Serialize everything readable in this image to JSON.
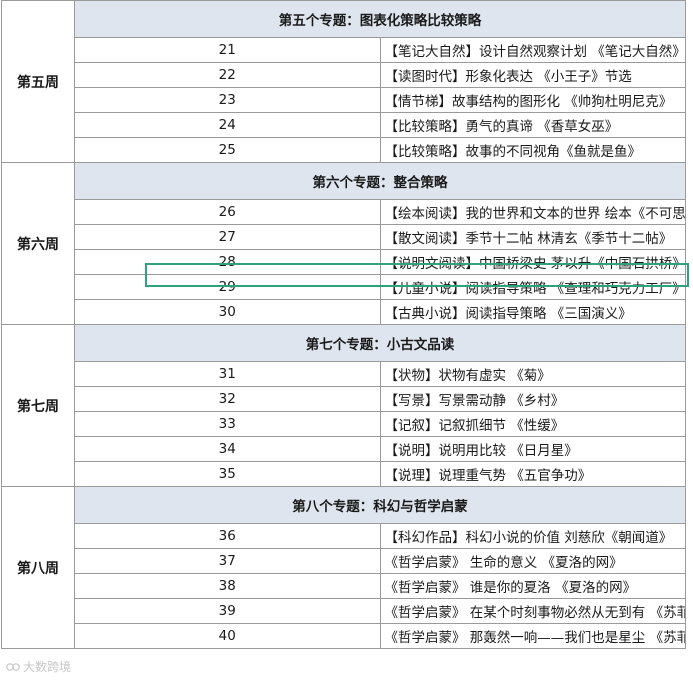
{
  "weeks": [
    {
      "week_label": "第五周",
      "topic": "第五个专题：图表化策略比较策略",
      "rows": [
        {
          "num": "21",
          "text": "【笔记大自然】设计自然观察计划 《笔记大自然》片段"
        },
        {
          "num": "22",
          "text": "【读图时代】形象化表达 《小王子》节选"
        },
        {
          "num": "23",
          "text": "【情节梯】故事结构的图形化 《帅狗杜明尼克》"
        },
        {
          "num": "24",
          "text": "【比较策略】勇气的真谛 《香草女巫》"
        },
        {
          "num": "25",
          "text": "【比较策略】故事的不同视角《鱼就是鱼》"
        }
      ]
    },
    {
      "week_label": "第六周",
      "topic": "第六个专题：整合策略",
      "rows": [
        {
          "num": "26",
          "text": "【绘本阅读】我的世界和文本的世界 绘本《不可思议的旅程》（ 文本的世界 ）"
        },
        {
          "num": "27",
          "text": "【散文阅读】季节十二帖 林清玄《季节十二帖》"
        },
        {
          "num": "28",
          "text": "【说明文阅读】中国桥梁史 茅以升《中国石拱桥》"
        },
        {
          "num": "29",
          "text": "【儿童小说】阅读指导策略 《查理和巧克力工厂》（ 威利 ）"
        },
        {
          "num": "30",
          "text": "【古典小说】阅读指导策略 《三国演义》"
        }
      ]
    },
    {
      "week_label": "第七周",
      "topic": "第七个专题：小古文品读",
      "rows": [
        {
          "num": "31",
          "text": "【状物】状物有虚实 《菊》"
        },
        {
          "num": "32",
          "text": "【写景】写景需动静 《乡村》"
        },
        {
          "num": "33",
          "text": "【记叙】记叙抓细节 《性缓》"
        },
        {
          "num": "34",
          "text": "【说明】说明用比较 《日月星》"
        },
        {
          "num": "35",
          "text": "【说理】说理重气势 《五官争功》"
        }
      ]
    },
    {
      "week_label": "第八周",
      "topic": "第八个专题：科幻与哲学启蒙",
      "rows": [
        {
          "num": "36",
          "text": "【科幻作品】科幻小说的价值 刘慈欣《朝闻道》"
        },
        {
          "num": "37",
          "text": "《哲学启蒙》 生命的意义 《夏洛的网》"
        },
        {
          "num": "38",
          "text": "《哲学启蒙》 谁是你的夏洛 《夏洛的网》"
        },
        {
          "num": "39",
          "text": "《哲学启蒙》 在某个时刻事物必然从无到有 《苏菲的世界》（从无到有）"
        },
        {
          "num": "40",
          "text": "《哲学启蒙》 那轰然一响——我们也是星尘 《苏菲的世界》（我们也是星尘 ）"
        }
      ]
    }
  ],
  "watermark": "大数跨境",
  "colors": {
    "header_bg": "#dfe5ee",
    "border": "#9a9a9a",
    "highlight": "#2ea27a"
  }
}
